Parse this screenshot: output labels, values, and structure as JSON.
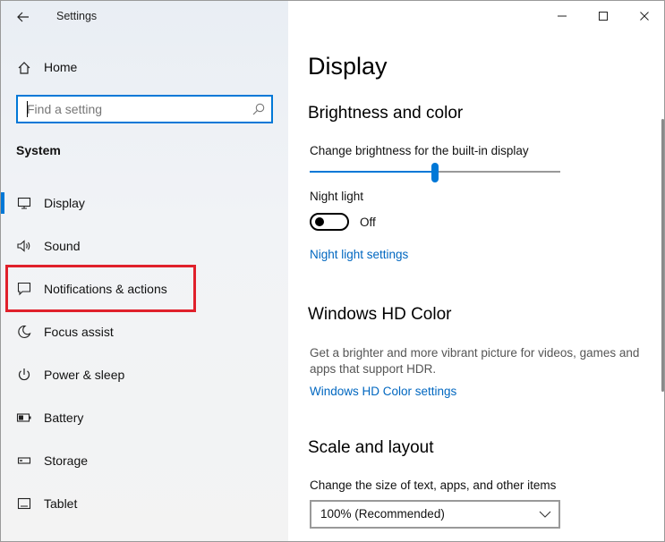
{
  "window": {
    "app_title": "Settings"
  },
  "sidebar": {
    "home_label": "Home",
    "search_placeholder": "Find a setting",
    "search_value": "",
    "section_title": "System",
    "items": [
      {
        "label": "Display",
        "icon": "monitor-icon",
        "active": true
      },
      {
        "label": "Sound",
        "icon": "speaker-icon",
        "active": false
      },
      {
        "label": "Notifications & actions",
        "icon": "notification-icon",
        "active": false
      },
      {
        "label": "Focus assist",
        "icon": "moon-icon",
        "active": false
      },
      {
        "label": "Power & sleep",
        "icon": "power-icon",
        "active": false
      },
      {
        "label": "Battery",
        "icon": "battery-icon",
        "active": false
      },
      {
        "label": "Storage",
        "icon": "storage-icon",
        "active": false
      },
      {
        "label": "Tablet",
        "icon": "tablet-icon",
        "active": false
      }
    ],
    "highlight_color": "#e0202b"
  },
  "main": {
    "page_title": "Display",
    "brightness": {
      "heading": "Brightness and color",
      "slider_label": "Change brightness for the built-in display",
      "slider_value_fraction": 0.5,
      "night_light_label": "Night light",
      "night_light_state": "Off",
      "night_light_link": "Night light settings"
    },
    "hd_color": {
      "heading": "Windows HD Color",
      "description": "Get a brighter and more vibrant picture for videos, games and apps that support HDR.",
      "link": "Windows HD Color settings"
    },
    "scale": {
      "heading": "Scale and layout",
      "label": "Change the size of text, apps, and other items",
      "selected": "100% (Recommended)"
    }
  },
  "colors": {
    "accent": "#0078d7",
    "link": "#0067c0"
  }
}
